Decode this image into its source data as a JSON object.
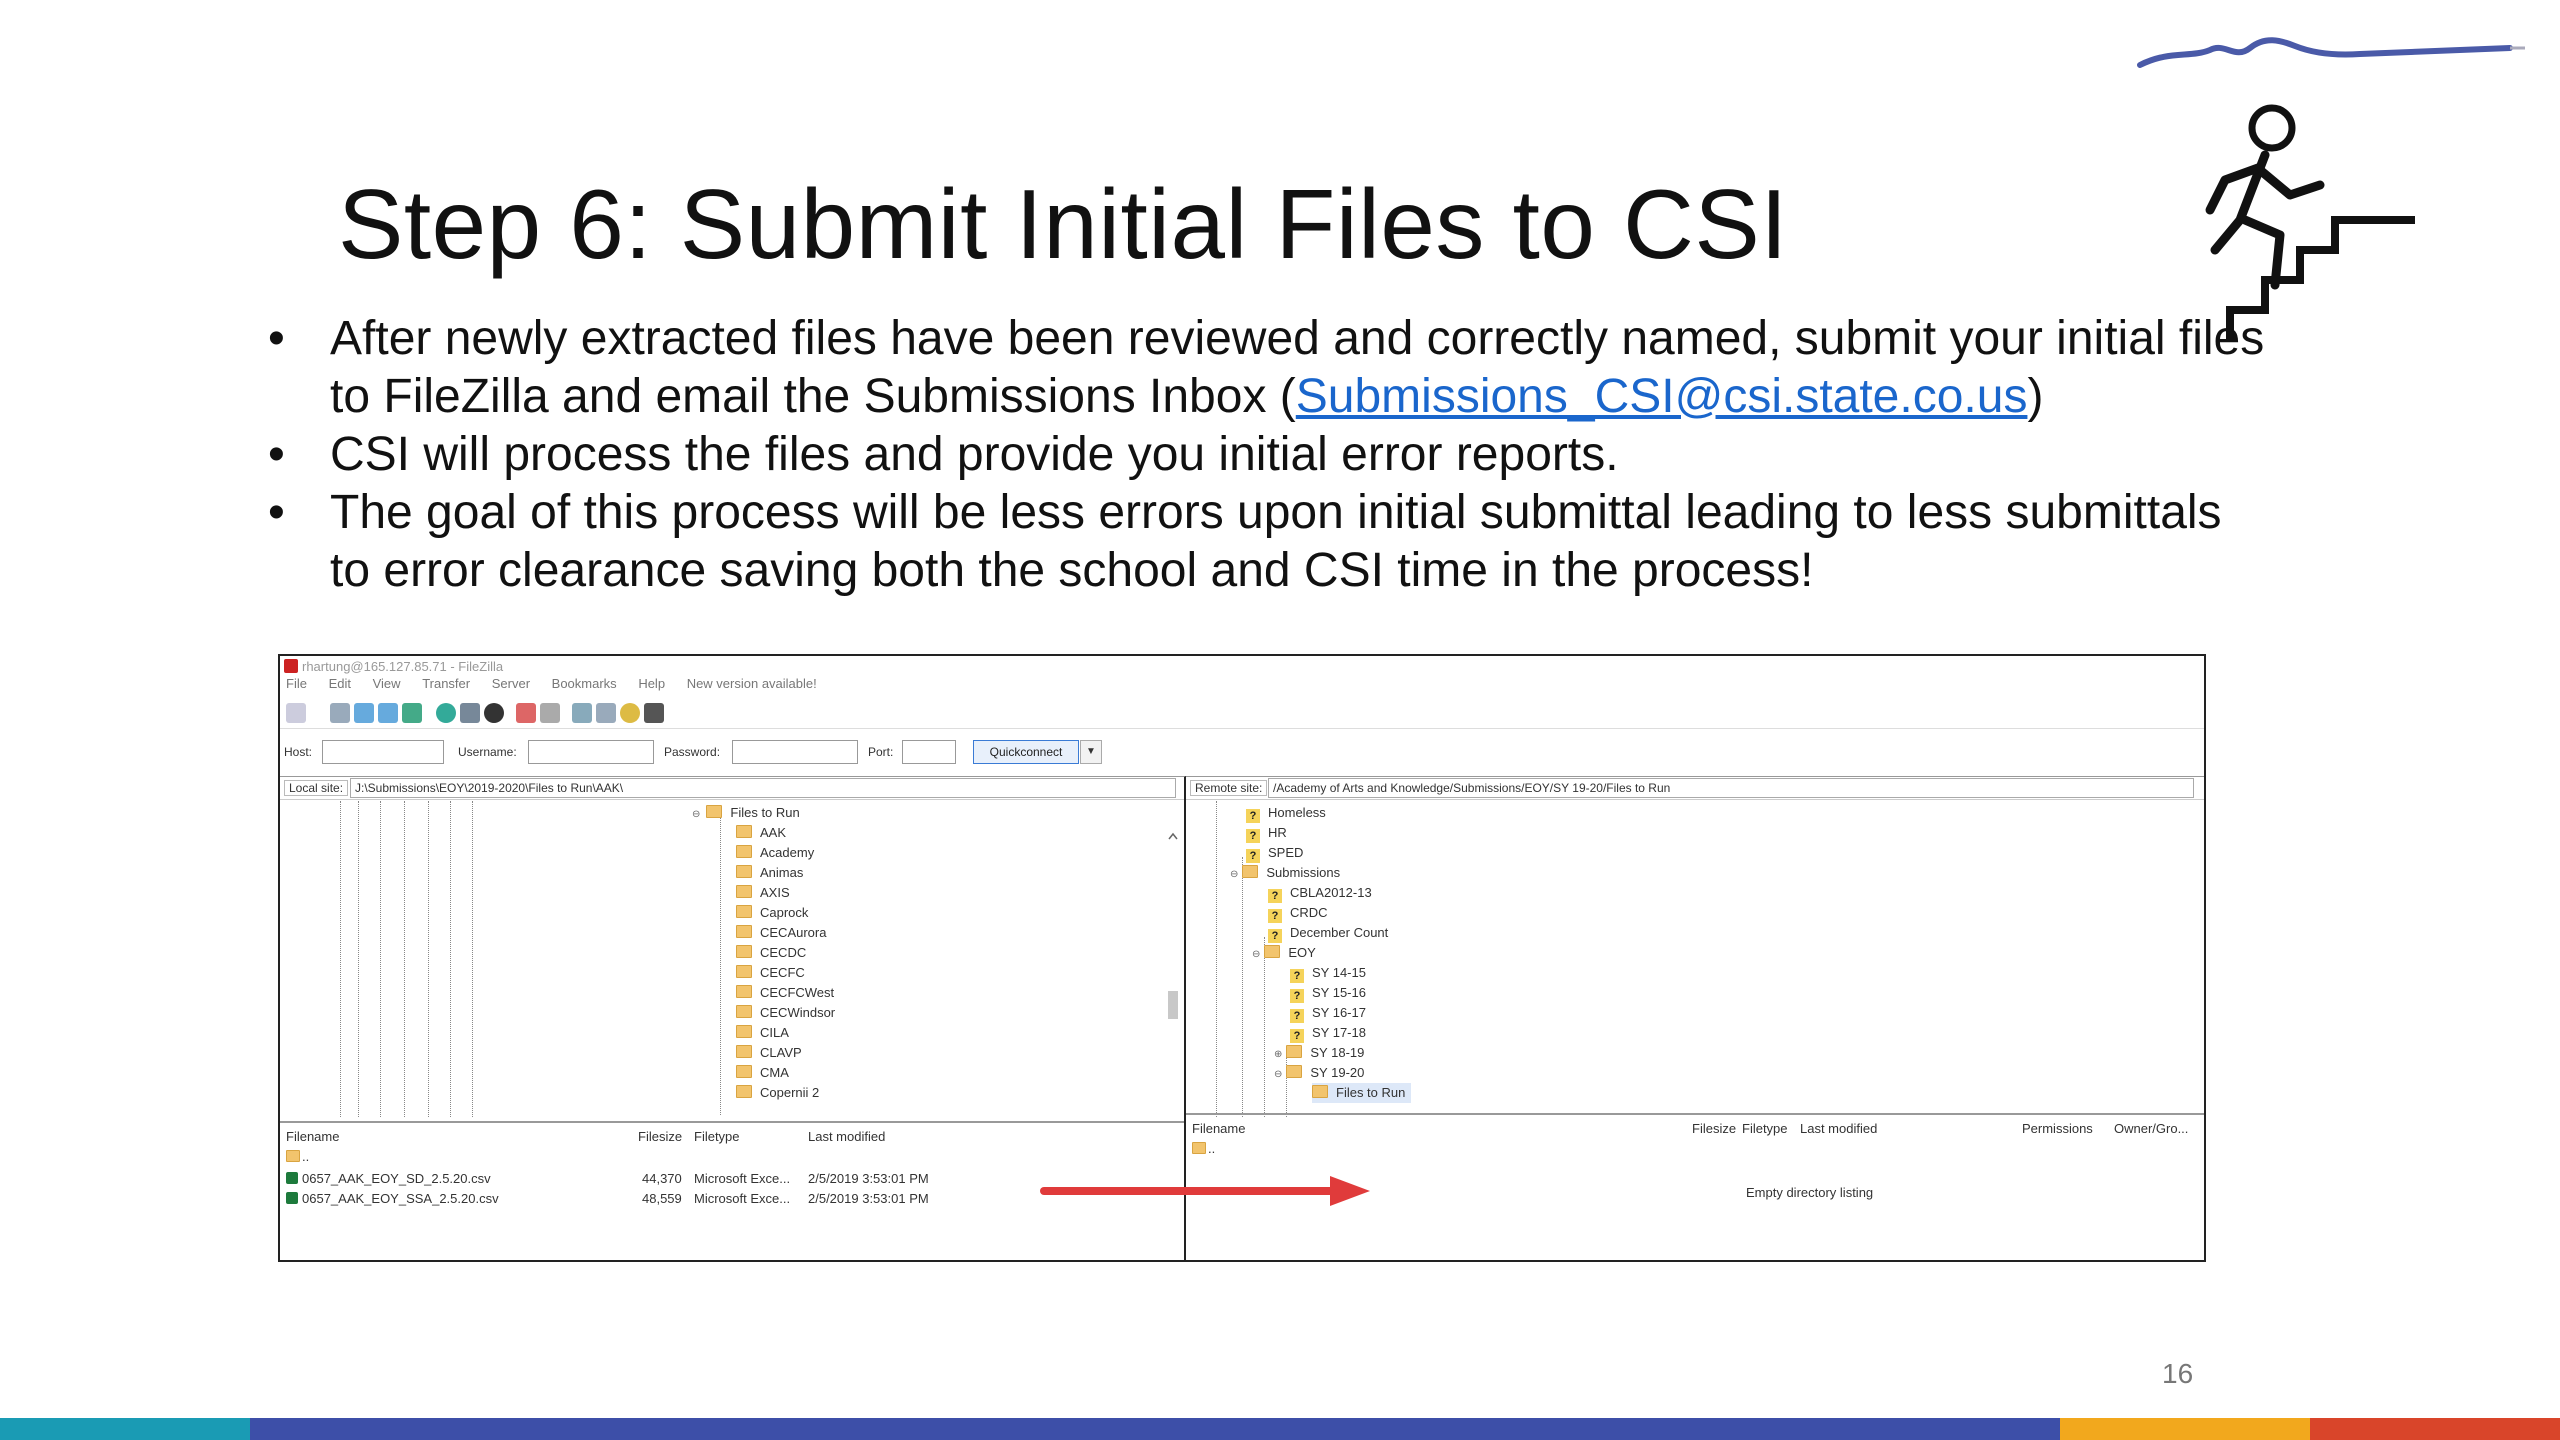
{
  "slide": {
    "title": "Step 6: Submit Initial Files to CSI",
    "bullets": [
      {
        "text_before": "After newly extracted files have been reviewed and correctly named, submit your initial files to FileZilla and email the Submissions Inbox (",
        "link": "Submissions_CSI@csi.state.co.us",
        "text_after": ")"
      },
      {
        "text": "CSI will process the files and provide you initial error reports."
      },
      {
        "text": "The goal of this process will be less errors upon initial submittal leading to less submittals to error clearance saving both the school and CSI time in the process!"
      }
    ],
    "bullet_glyph": "•",
    "page_number": "16"
  },
  "filezilla": {
    "window_title": "rhartung@165.127.85.71 - FileZilla",
    "menu": [
      "File",
      "Edit",
      "View",
      "Transfer",
      "Server",
      "Bookmarks",
      "Help",
      "New version available!"
    ],
    "quickconnect": {
      "host_label": "Host:",
      "username_label": "Username:",
      "password_label": "Password:",
      "port_label": "Port:",
      "button": "Quickconnect",
      "dropdown": "▼"
    },
    "local": {
      "site_label": "Local site:",
      "path": "J:\\Submissions\\EOY\\2019-2020\\Files to Run\\AAK\\",
      "tree_root": "Files to Run",
      "folders": [
        "AAK",
        "Academy",
        "Animas",
        "AXIS",
        "Caprock",
        "CECAurora",
        "CECDC",
        "CECFC",
        "CECFCWest",
        "CECWindsor",
        "CILA",
        "CLAVP",
        "CMA",
        "Copernii 2"
      ],
      "columns": [
        "Filename",
        "Filesize",
        "Filetype",
        "Last modified"
      ],
      "parent_dir": "..",
      "files": [
        {
          "name": "0657_AAK_EOY_SD_2.5.20.csv",
          "size": "44,370",
          "type": "Microsoft Exce...",
          "modified": "2/5/2019 3:53:01 PM"
        },
        {
          "name": "0657_AAK_EOY_SSA_2.5.20.csv",
          "size": "48,559",
          "type": "Microsoft Exce...",
          "modified": "2/5/2019 3:53:01 PM"
        }
      ]
    },
    "remote": {
      "site_label": "Remote site:",
      "path": "/Academy of Arts and Knowledge/Submissions/EOY/SY 19-20/Files to Run",
      "tree": [
        {
          "label": "Homeless",
          "kind": "q",
          "level": 0
        },
        {
          "label": "HR",
          "kind": "q",
          "level": 0
        },
        {
          "label": "SPED",
          "kind": "q",
          "level": 0
        },
        {
          "label": "Submissions",
          "kind": "folder",
          "level": 0
        },
        {
          "label": "CBLA2012-13",
          "kind": "q",
          "level": 1
        },
        {
          "label": "CRDC",
          "kind": "q",
          "level": 1
        },
        {
          "label": "December Count",
          "kind": "q",
          "level": 1
        },
        {
          "label": "EOY",
          "kind": "folder",
          "level": 1
        },
        {
          "label": "SY 14-15",
          "kind": "q",
          "level": 2
        },
        {
          "label": "SY 15-16",
          "kind": "q",
          "level": 2
        },
        {
          "label": "SY 16-17",
          "kind": "q",
          "level": 2
        },
        {
          "label": "SY 17-18",
          "kind": "q",
          "level": 2
        },
        {
          "label": "SY 18-19",
          "kind": "folder",
          "level": 2
        },
        {
          "label": "SY 19-20",
          "kind": "folder",
          "level": 2
        },
        {
          "label": "Files to Run",
          "kind": "folder",
          "level": 3
        }
      ],
      "columns": [
        "Filename",
        "Filesize",
        "Filetype",
        "Last modified",
        "Permissions",
        "Owner/Gro..."
      ],
      "parent_dir": "..",
      "empty_text": "Empty directory listing"
    }
  },
  "colors": {
    "link": "#1a66cc",
    "arrow": "#e03b3b",
    "band": [
      "#1a9bb4",
      "#3d4fa8",
      "#f2a81d",
      "#d9452a"
    ]
  }
}
